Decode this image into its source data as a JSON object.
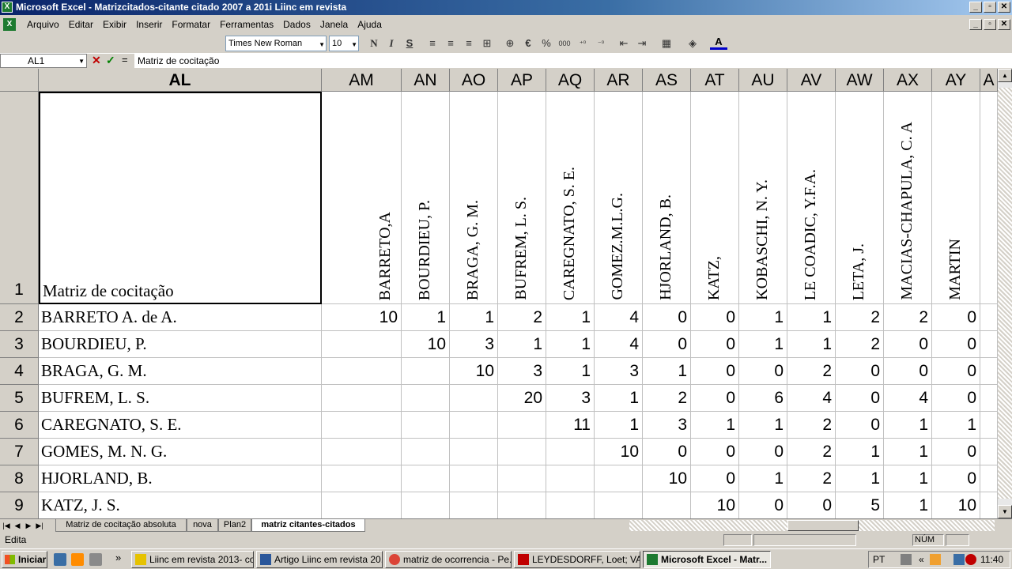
{
  "window": {
    "title": "Microsoft Excel - Matrizcitados-citante citado 2007 a 201i Liinc em revista",
    "minimize": "_",
    "restore": "▫",
    "close": "✕"
  },
  "menu": [
    "Arquivo",
    "Editar",
    "Exibir",
    "Inserir",
    "Formatar",
    "Ferramentas",
    "Dados",
    "Janela",
    "Ajuda"
  ],
  "toolbar": {
    "font": "Times New Roman",
    "size": "10",
    "bold": "N",
    "italic": "I",
    "underline": "S",
    "currency": "€",
    "percent": "%",
    "thousands": "000"
  },
  "formula": {
    "name_box": "AL1",
    "cancel": "✕",
    "enter": "✓",
    "eq": "=",
    "content": "Matriz de cocitação"
  },
  "columns": [
    "AL",
    "AM",
    "AN",
    "AO",
    "AP",
    "AQ",
    "AR",
    "AS",
    "AT",
    "AU",
    "AV",
    "AW",
    "AX",
    "AY",
    "A"
  ],
  "header_row": {
    "corner_label": "Matriz de cocitação",
    "names": [
      "BARRETO,A",
      "BOURDIEU, P.",
      "BRAGA, G. M.",
      "BUFREM, L. S.",
      "CAREGNATO, S. E.",
      "GOMEZ.M.L.G.",
      "HJORLAND, B.",
      "KATZ,",
      "KOBASCHI, N. Y.",
      "LE COADIC, Y.F.A.",
      "LETA, J.",
      "MACIAS-CHAPULA, C. A",
      "MARTIN"
    ]
  },
  "rows": [
    {
      "n": "1"
    },
    {
      "n": "2",
      "label": "BARRETO A. de A.",
      "values": [
        "10",
        "1",
        "1",
        "2",
        "1",
        "4",
        "0",
        "0",
        "1",
        "1",
        "2",
        "2",
        "0"
      ]
    },
    {
      "n": "3",
      "label": "BOURDIEU, P.",
      "values": [
        "",
        "10",
        "3",
        "1",
        "1",
        "4",
        "0",
        "0",
        "1",
        "1",
        "2",
        "0",
        "0"
      ]
    },
    {
      "n": "4",
      "label": "BRAGA, G. M.",
      "values": [
        "",
        "",
        "10",
        "3",
        "1",
        "3",
        "1",
        "0",
        "0",
        "2",
        "0",
        "0",
        "0"
      ]
    },
    {
      "n": "5",
      "label": "BUFREM, L. S.",
      "values": [
        "",
        "",
        "",
        "20",
        "3",
        "1",
        "2",
        "0",
        "6",
        "4",
        "0",
        "4",
        "0"
      ]
    },
    {
      "n": "6",
      "label": "CAREGNATO, S. E.",
      "values": [
        "",
        "",
        "",
        "",
        "11",
        "1",
        "3",
        "1",
        "1",
        "2",
        "0",
        "1",
        "1"
      ]
    },
    {
      "n": "7",
      "label": "GOMES, M. N. G.",
      "values": [
        "",
        "",
        "",
        "",
        "",
        "10",
        "0",
        "0",
        "0",
        "2",
        "1",
        "1",
        "0"
      ]
    },
    {
      "n": "8",
      "label": "HJORLAND, B.",
      "values": [
        "",
        "",
        "",
        "",
        "",
        "",
        "10",
        "0",
        "1",
        "2",
        "1",
        "1",
        "0"
      ]
    },
    {
      "n": "9",
      "label": "KATZ, J. S.",
      "values": [
        "",
        "",
        "",
        "",
        "",
        "",
        "",
        "10",
        "0",
        "0",
        "5",
        "1",
        "10"
      ]
    }
  ],
  "sheet_tabs": [
    "Matriz de cocitação absoluta",
    "nova",
    "Plan2",
    "matriz citantes-citados"
  ],
  "status": {
    "mode": "Edita",
    "num": "NÚM"
  },
  "taskbar": {
    "start": "Iniciar",
    "items": [
      "Liinc em revista 2013- co...",
      "Artigo Liinc em revista 20...",
      "matriz de ocorrencia - Pe...",
      "LEYDESDORFF, Loet; VA...",
      "Microsoft Excel - Matr..."
    ],
    "lang": "PT",
    "clock": "11:40"
  }
}
